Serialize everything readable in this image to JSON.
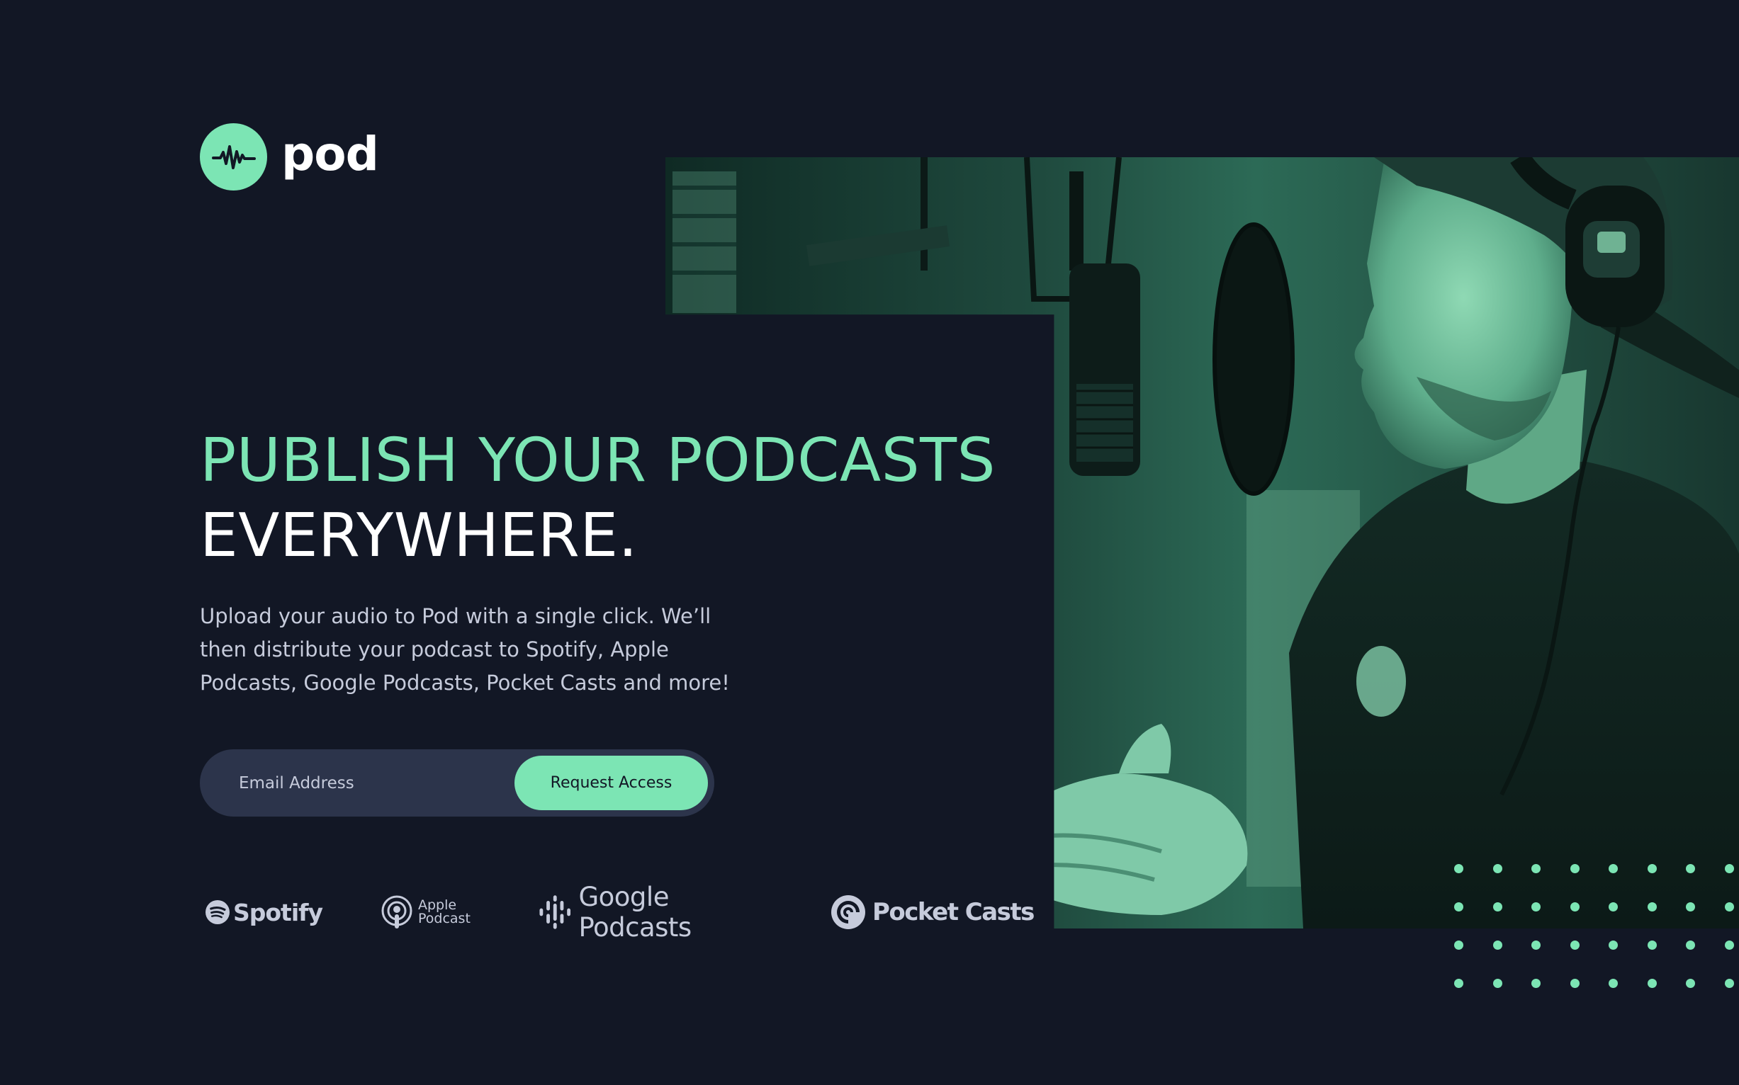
{
  "colors": {
    "background": "#121725",
    "accent": "#7ce5b4",
    "input_bg": "#2c344b",
    "muted_text": "#c6cbdb",
    "white": "#ffffff"
  },
  "brand": {
    "name": "pod",
    "icon": "audio-wave-icon"
  },
  "hero": {
    "headline_accent": "PUBLISH YOUR PODCASTS",
    "headline_plain": "EVERYWHERE.",
    "intro": "Upload your audio to Pod with a single click. We’ll then distribute your podcast to Spotify, Apple Podcasts, Google Podcasts, Pocket Casts and more!",
    "photo": "podcaster-recording-at-microphone-image"
  },
  "form": {
    "email_placeholder": "Email Address",
    "button_label": "Request Access"
  },
  "platforms": {
    "spotify": {
      "name": "Spotify",
      "icon": "spotify-icon"
    },
    "apple": {
      "line1": "Apple",
      "line2": "Podcast",
      "icon": "apple-podcasts-icon"
    },
    "google": {
      "name": "Google Podcasts",
      "icon": "google-podcasts-icon"
    },
    "pocket": {
      "name": "Pocket Casts",
      "icon": "pocket-casts-icon"
    }
  },
  "decoration": {
    "dots": "dot-grid-pattern"
  }
}
